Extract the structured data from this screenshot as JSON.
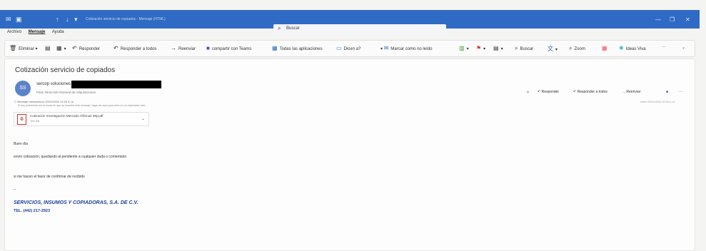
{
  "titlebar": {
    "app_icon": "outlook-icon",
    "title": "Cotización servicio de copiados - Mensaje (HTML)",
    "search_placeholder": "Buscar",
    "minimize": "—",
    "restore": "❐",
    "close": "✕"
  },
  "menu": [
    "Archivo",
    "Mensaje",
    "Ayuda"
  ],
  "ribbon": {
    "delete": "Eliminar",
    "reply": "Responder",
    "reply_all": "Responder a todos",
    "forward": "Reenviar",
    "teams": "compartir con Teams",
    "apps": "Todas las aplicaciones",
    "share": "Dicen a?",
    "mark_unread": "Marcar como no leído",
    "find": "Buscar",
    "zoom": "Zoom",
    "ideas": "Ideas Viva",
    "more": "···"
  },
  "email": {
    "subject": "Cotización servicio de copiados",
    "avatar_initials": "SS",
    "sender": "sercop soluciones -",
    "to": "Para: Dirección General de Adquisiciones",
    "info": "Mensaje reenviado el 22/01/2024 11:25 a. m.",
    "info2": "Si hay problemas con el modo en que se muestra este mensaje, haga clic aquí para verlo en un explorador web.",
    "attachment_name": "Cotización Investigación Mercado Oficinas Mty.pdf",
    "attachment_size": "100 KB",
    "actions": {
      "emoji": "☺",
      "reply": "Responder",
      "reply_all": "Responder a todos",
      "forward": "Reenviar",
      "more": "···"
    },
    "date": "lunes 22/01/2024 10:59 a. m.",
    "greeting": "Buen día",
    "line1": "envío cotización, quedando al pendiente a cualquier duda o comentario",
    "line2": "si me hacen el favor de confirmar de recibido",
    "line3": "--",
    "signature_company": "SERVICIOS, INSUMOS Y COPIADORAS, S.A. DE C.V.",
    "signature_phone": "TEL. (442) 217-2923"
  },
  "colors": {
    "titlebar": "#2f6bc4",
    "signature": "#1d3f9c",
    "pdf": "#cc3333"
  }
}
